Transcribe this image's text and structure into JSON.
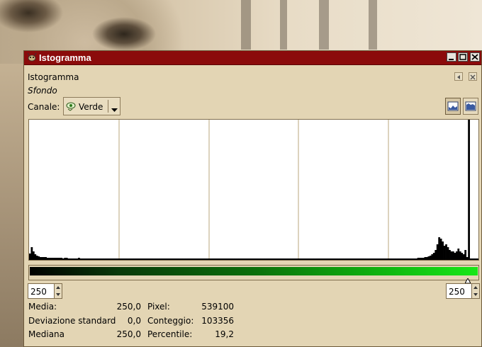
{
  "window": {
    "title": "Istogramma"
  },
  "panel": {
    "title": "Istogramma",
    "layer": "Sfondo"
  },
  "channel": {
    "label": "Canale:",
    "value": "Verde"
  },
  "range": {
    "start": "250",
    "end": "250"
  },
  "stats": {
    "labels": [
      "Media:",
      "Deviazione standard",
      "Mediana"
    ],
    "values": [
      "250,0",
      "0,0",
      "250,0"
    ],
    "labels2": [
      "Pixel:",
      "Conteggio:",
      "Percentile:"
    ],
    "values2": [
      "539100",
      "103356",
      "19,2"
    ]
  },
  "colors": {
    "titlebar": "#8b0b0b",
    "panel_bg": "#e3d5b4",
    "histogram_fill": "#000000",
    "gradient_end": "#18e818"
  },
  "histogram": {
    "bins_shown": "0-255",
    "selected_value": 250,
    "heights": [
      9,
      18,
      12,
      8,
      6,
      5,
      4,
      4,
      4,
      4,
      3,
      3,
      3,
      3,
      3,
      3,
      3,
      3,
      3,
      2,
      3,
      3,
      2,
      2,
      2,
      2,
      2,
      2,
      3,
      2,
      2,
      2,
      2,
      2,
      2,
      2,
      2,
      2,
      2,
      2,
      2,
      2,
      2,
      2,
      2,
      2,
      2,
      2,
      2,
      2,
      2,
      2,
      2,
      2,
      2,
      2,
      2,
      2,
      2,
      2,
      2,
      2,
      2,
      2,
      2,
      2,
      2,
      2,
      2,
      2,
      2,
      2,
      2,
      2,
      2,
      2,
      2,
      2,
      2,
      2,
      2,
      2,
      2,
      2,
      2,
      2,
      2,
      2,
      2,
      2,
      2,
      2,
      2,
      2,
      2,
      2,
      2,
      2,
      2,
      2,
      2,
      2,
      2,
      2,
      2,
      2,
      2,
      2,
      2,
      2,
      2,
      2,
      2,
      2,
      2,
      2,
      2,
      2,
      2,
      2,
      2,
      2,
      2,
      2,
      2,
      2,
      2,
      2,
      2,
      2,
      2,
      2,
      2,
      2,
      2,
      2,
      2,
      2,
      2,
      2,
      2,
      2,
      2,
      2,
      2,
      2,
      2,
      2,
      2,
      2,
      2,
      2,
      2,
      2,
      2,
      2,
      2,
      2,
      2,
      2,
      2,
      2,
      2,
      2,
      2,
      2,
      2,
      2,
      2,
      2,
      2,
      2,
      2,
      2,
      2,
      2,
      2,
      2,
      2,
      2,
      2,
      2,
      2,
      2,
      2,
      2,
      2,
      2,
      2,
      2,
      2,
      2,
      2,
      2,
      2,
      2,
      2,
      2,
      2,
      2,
      2,
      2,
      2,
      2,
      2,
      2,
      2,
      2,
      2,
      2,
      2,
      2,
      2,
      2,
      2,
      2,
      2,
      2,
      2,
      2,
      2,
      2,
      3,
      3,
      3,
      3,
      4,
      4,
      5,
      6,
      8,
      10,
      14,
      22,
      32,
      30,
      26,
      20,
      22,
      18,
      14,
      12,
      12,
      10,
      12,
      16,
      12,
      10,
      8,
      14,
      4,
      198,
      2,
      2,
      2,
      2,
      2
    ]
  }
}
